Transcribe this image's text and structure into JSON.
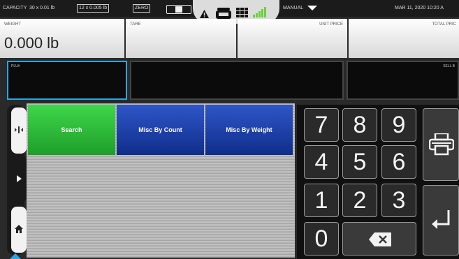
{
  "status_bar": {
    "capacity_label": "CAPACITY",
    "capacity_value": "30 x 0.01 lb",
    "division_value": "12 x 0.005 lb",
    "zero_indicator": "ZERO",
    "mode_label": "MANUAL",
    "datetime": "MAR 11, 2020 10:20 A"
  },
  "top_panels": {
    "weight_label": "WEIGHT",
    "weight_value": "0.000 lb",
    "tare_label": "TARE",
    "unit_price_label": "UNIT PRICE",
    "total_price_label": "TOTAL PRIC"
  },
  "inputs": {
    "plu_label": "PLU#",
    "sell_label": "SELL B"
  },
  "tiles": {
    "search_label": "Search",
    "misc_count_label": "Misc By Count",
    "misc_weight_label": "Misc By Weight"
  },
  "keypad": {
    "k7": "7",
    "k8": "8",
    "k9": "9",
    "k4": "4",
    "k5": "5",
    "k6": "6",
    "k1": "1",
    "k2": "2",
    "k3": "3",
    "k0": "0"
  },
  "icons": {
    "warning": "warning-icon",
    "scale": "scale-icon",
    "grid": "grid-icon",
    "signal": "signal-icon",
    "printer": "printer-icon",
    "enter": "enter-icon",
    "backspace": "backspace-icon",
    "home": "home-icon"
  },
  "colors": {
    "accent_blue": "#2aa6e3",
    "search_green": "#2cbf3a",
    "misc_blue": "#1c3ea8",
    "signal_green": "#6bd13a"
  }
}
